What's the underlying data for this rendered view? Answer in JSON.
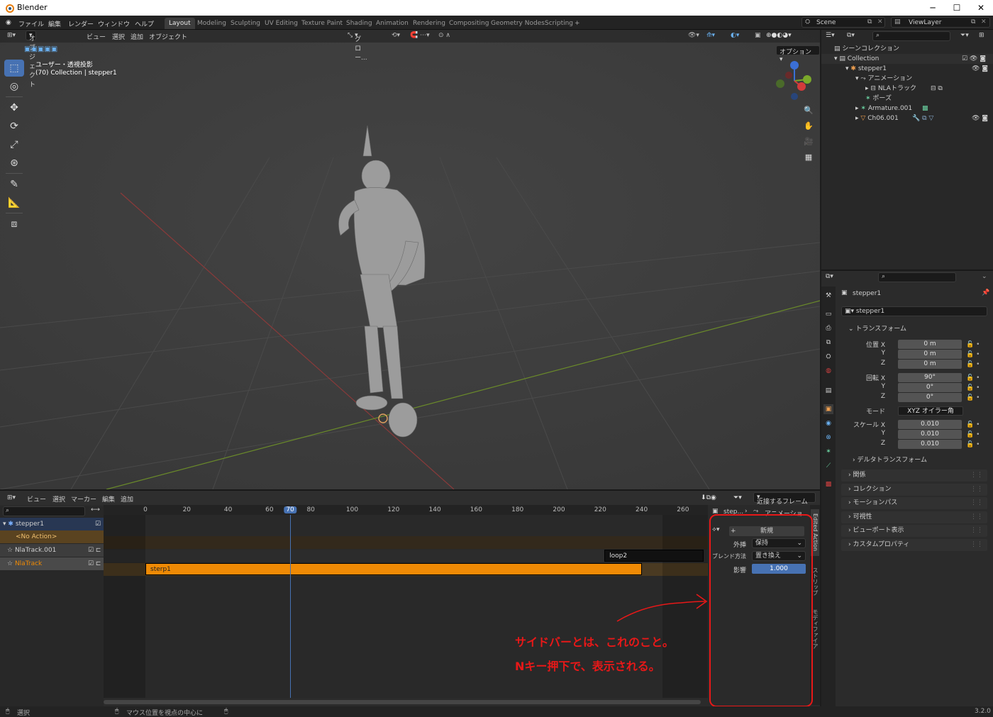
{
  "window": {
    "title": "Blender"
  },
  "menu": [
    "ファイル",
    "編集",
    "レンダー",
    "ウィンドウ",
    "ヘルプ"
  ],
  "workspaces": [
    {
      "label": "Layout",
      "active": true
    },
    {
      "label": "Modeling"
    },
    {
      "label": "Sculpting"
    },
    {
      "label": "UV Editing"
    },
    {
      "label": "Texture Paint"
    },
    {
      "label": "Shading"
    },
    {
      "label": "Animation"
    },
    {
      "label": "Rendering"
    },
    {
      "label": "Compositing"
    },
    {
      "label": "Geometry Nodes"
    },
    {
      "label": "Scripting"
    }
  ],
  "scene": {
    "name": "Scene",
    "view_layer": "ViewLayer"
  },
  "viewport": {
    "mode": "オブジェクト",
    "menus": [
      "ビュー",
      "選択",
      "追加",
      "オブジェクト"
    ],
    "transform_orientation": "グロー...",
    "view_name": "ユーザー・透視投影",
    "collection_info": "(70) Collection | stepper1",
    "options_label": "オプション"
  },
  "nla": {
    "menus": [
      "ビュー",
      "選択",
      "マーカー",
      "編集",
      "追加"
    ],
    "snap_label": "近接するフレーム",
    "ruler": [
      0,
      20,
      40,
      60,
      70,
      80,
      100,
      120,
      140,
      160,
      180,
      200,
      220,
      240,
      260
    ],
    "current_frame": "70",
    "channels": [
      {
        "label": "stepper1",
        "kind": "object"
      },
      {
        "label": "<No Action>",
        "kind": "action"
      },
      {
        "label": "NlaTrack.001",
        "kind": "track"
      },
      {
        "label": "NlaTrack",
        "kind": "track",
        "active": true
      }
    ],
    "strips": [
      {
        "label": "sterp1",
        "track": "NlaTrack",
        "start": 0,
        "end": 240,
        "color": "#ef8a05"
      },
      {
        "label": "loop2",
        "track": "NlaTrack.001",
        "start": 222,
        "end": 270,
        "color": "#111111"
      }
    ],
    "action_range": {
      "start": 0,
      "end": 250
    },
    "sidebar": {
      "object": "step...",
      "section": "アニメーショ...",
      "new_label": "新規",
      "rows": [
        {
          "label": "外挿",
          "value": "保持"
        },
        {
          "label": "ブレンド方法",
          "value": "置き換え"
        },
        {
          "label": "影響",
          "value": "1.000"
        }
      ],
      "tabs": [
        "Edited Action",
        "ストリップ",
        "モディファイア"
      ]
    }
  },
  "outliner": {
    "rows": [
      {
        "label": "シーンコレクション",
        "indent": 0
      },
      {
        "label": "Collection",
        "indent": 1
      },
      {
        "label": "stepper1",
        "indent": 2
      },
      {
        "label": "アニメーション",
        "indent": 3
      },
      {
        "label": "NLAトラック",
        "indent": 4
      },
      {
        "label": "ポーズ",
        "indent": 3
      },
      {
        "label": "Armature.001",
        "indent": 3
      },
      {
        "label": "Ch06.001",
        "indent": 3
      }
    ]
  },
  "properties": {
    "object_name": "stepper1",
    "data_name": "stepper1",
    "transform_title": "トランスフォーム",
    "location": {
      "label": "位置 X",
      "values": [
        "0 m",
        "0 m",
        "0 m"
      ]
    },
    "rotation": {
      "label": "回転 X",
      "values": [
        "90°",
        "0°",
        "0°"
      ]
    },
    "mode": {
      "label": "モード",
      "value": "XYZ オイラー角"
    },
    "scale": {
      "label": "スケール X",
      "values": [
        "0.010",
        "0.010",
        "0.010"
      ]
    },
    "axis_labels": [
      "Y",
      "Z"
    ],
    "delta": "デルタトランスフォーム",
    "panels": [
      "関係",
      "コレクション",
      "モーションパス",
      "可視性",
      "ビューポート表示",
      "カスタムプロパティ"
    ]
  },
  "status": {
    "select": "選択",
    "center": "マウス位置を視点の中心に",
    "version": "3.2.0"
  },
  "annotation": {
    "line1": "サイドバーとは、これのこと。",
    "line2": "Nキー押下で、表示される。",
    "color": "#e81818"
  },
  "colors": {
    "accent": "#4772b3",
    "strip": "#ef8a05",
    "playhead": "#4772b3"
  }
}
